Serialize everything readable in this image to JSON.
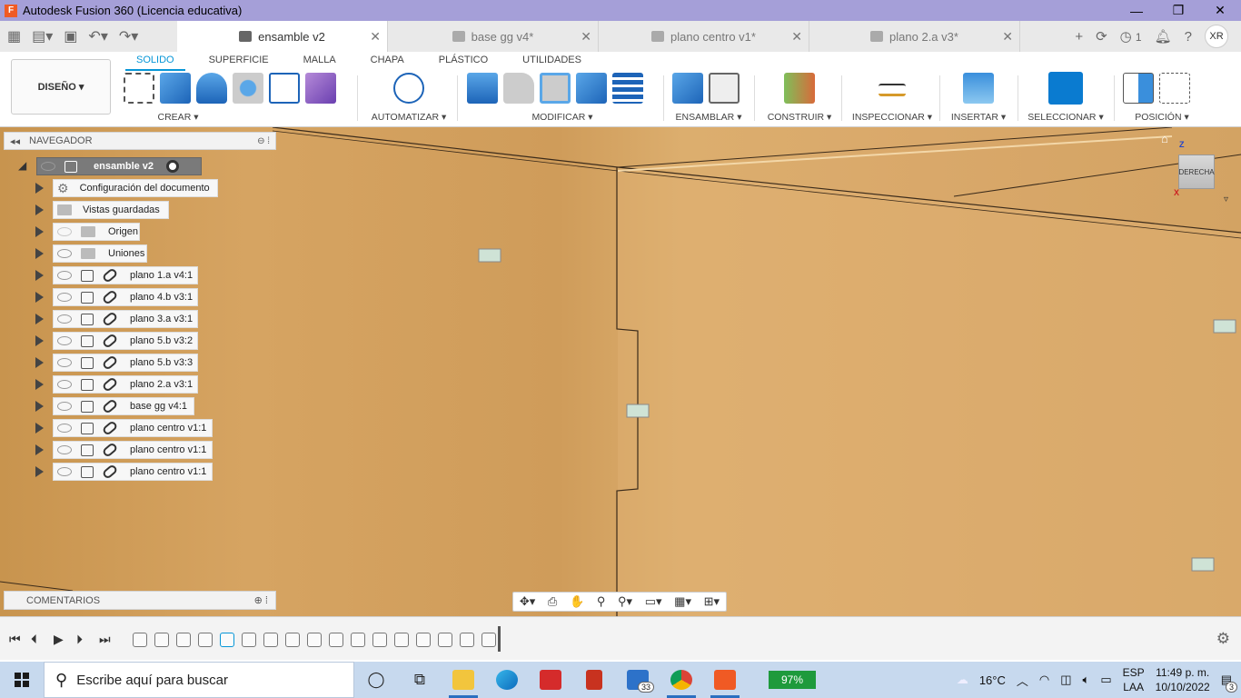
{
  "window": {
    "title": "Autodesk Fusion 360 (Licencia educativa)"
  },
  "tabs": [
    {
      "label": "ensamble v2",
      "active": true
    },
    {
      "label": "base gg v4*",
      "active": false
    },
    {
      "label": "plano centro v1*",
      "active": false
    },
    {
      "label": "plano 2.a v3*",
      "active": false
    }
  ],
  "tab_right": {
    "jobs_count": "1",
    "user_initials": "XR"
  },
  "ribbon": {
    "workspace": "DISEÑO",
    "tabs": [
      "SOLIDO",
      "SUPERFICIE",
      "MALLA",
      "CHAPA",
      "PLÁSTICO",
      "UTILIDADES"
    ],
    "active_tab": "SOLIDO",
    "groups": {
      "crear": "CREAR",
      "automatizar": "AUTOMATIZAR",
      "modificar": "MODIFICAR",
      "ensamblar": "ENSAMBLAR",
      "construir": "CONSTRUIR",
      "inspeccionar": "INSPECCIONAR",
      "insertar": "INSERTAR",
      "seleccionar": "SELECCIONAR",
      "posicion": "POSICIÓN"
    }
  },
  "browser": {
    "title": "NAVEGADOR",
    "root": "ensamble v2",
    "items": [
      "Configuración del documento",
      "Vistas guardadas",
      "Origen",
      "Uniones",
      "plano 1.a v4:1",
      "plano 4.b v3:1",
      "plano 3.a v3:1",
      "plano 5.b v3:2",
      "plano 5.b v3:3",
      "plano 2.a v3:1",
      "base gg v4:1",
      "plano centro v1:1",
      "plano centro v1:1",
      "plano centro v1:1"
    ]
  },
  "comments": {
    "title": "COMENTARIOS"
  },
  "viewcube": {
    "face": "DERECHA",
    "axis_z": "Z",
    "axis_x": "X"
  },
  "taskbar": {
    "search_placeholder": "Escribe aquí para buscar",
    "mail_badge": "33",
    "battery": "97%",
    "weather": "16°C",
    "lang_top": "ESP",
    "lang_bottom": "LAA",
    "time": "11:49 p. m.",
    "date": "10/10/2022",
    "notifications": "3"
  },
  "colors": {
    "accent": "#0696d7",
    "title_bar": "#a59fd8",
    "taskbar": "#c7d9ee",
    "wood": "#d6a462"
  }
}
